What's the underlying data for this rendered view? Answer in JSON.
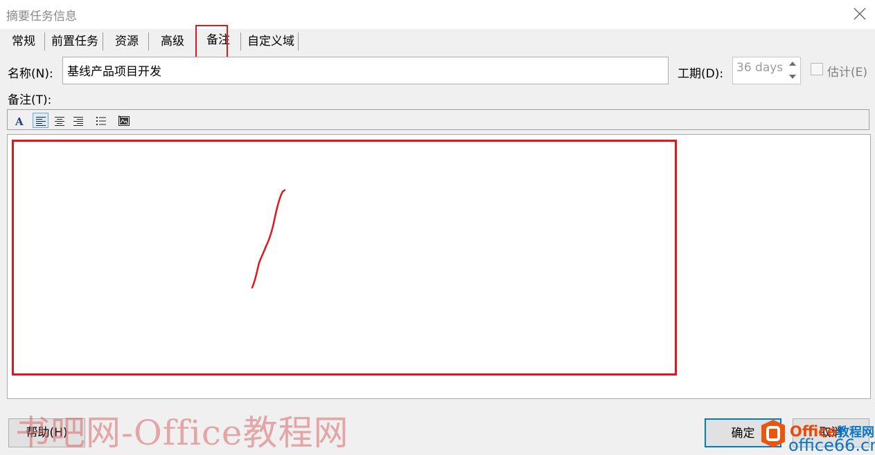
{
  "window": {
    "title": "摘要任务信息",
    "close_icon": "close-icon"
  },
  "tabs": [
    {
      "label": "常规"
    },
    {
      "label": "前置任务"
    },
    {
      "label": "资源"
    },
    {
      "label": "高级"
    },
    {
      "label": "备注"
    },
    {
      "label": "自定义域"
    }
  ],
  "active_tab": "备注",
  "fields": {
    "name_label": "名称(N):",
    "name_value": "基线产品项目开发",
    "duration_label": "工期(D):",
    "duration_value": "36 days",
    "estimated_label": "估计(E)",
    "estimated_checked": false,
    "notes_label": "备注(T):"
  },
  "notes_toolbar": [
    "font-icon",
    "align-left-icon",
    "align-center-icon",
    "align-right-icon",
    "bullet-list-icon",
    "insert-object-icon"
  ],
  "buttons": {
    "help": "帮助(H)",
    "ok": "确定",
    "cancel": "取消"
  },
  "watermark": {
    "text": "书吧网-Office教程网",
    "logo_brand": "Office",
    "logo_cn": "教程网",
    "logo_domain": "office66.cn"
  },
  "colors": {
    "highlight": "#e0161b",
    "default_button_border": "#0078d7"
  }
}
